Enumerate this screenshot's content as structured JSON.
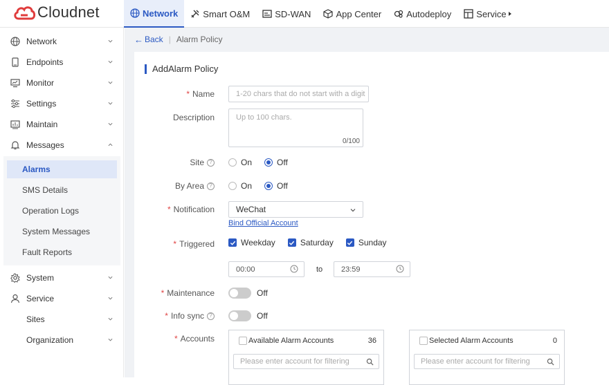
{
  "brand": {
    "name": "Cloudnet",
    "color": "#e03c3c"
  },
  "topnav": [
    {
      "label": "Network",
      "icon": "globe-icon",
      "active": true
    },
    {
      "label": "Smart O&M",
      "icon": "tools-icon"
    },
    {
      "label": "SD-WAN",
      "icon": "sdwan-icon"
    },
    {
      "label": "App Center",
      "icon": "cube-icon"
    },
    {
      "label": "Autodeploy",
      "icon": "deploy-icon"
    },
    {
      "label": "Service",
      "icon": "service-icon"
    }
  ],
  "sidebar": {
    "items": [
      {
        "label": "Network",
        "icon": "globe-icon"
      },
      {
        "label": "Endpoints",
        "icon": "device-icon"
      },
      {
        "label": "Monitor",
        "icon": "monitor-icon"
      },
      {
        "label": "Settings",
        "icon": "sliders-icon"
      },
      {
        "label": "Maintain",
        "icon": "chart-icon"
      },
      {
        "label": "Messages",
        "icon": "bell-icon",
        "expanded": true
      },
      {
        "label": "System",
        "icon": "gear-icon"
      },
      {
        "label": "Service",
        "icon": "user-icon"
      },
      {
        "label": "Sites",
        "icon": ""
      },
      {
        "label": "Organization",
        "icon": ""
      }
    ],
    "messages_sub": [
      {
        "label": "Alarms",
        "active": true
      },
      {
        "label": "SMS Details"
      },
      {
        "label": "Operation Logs"
      },
      {
        "label": "System Messages"
      },
      {
        "label": "Fault Reports"
      }
    ]
  },
  "breadcrumb": {
    "back": "Back",
    "current": "Alarm Policy"
  },
  "form": {
    "title": "AddAlarm Policy",
    "name": {
      "label": "Name",
      "placeholder": "1-20 chars that do not start with a digit"
    },
    "description": {
      "label": "Description",
      "placeholder": "Up to 100 chars.",
      "counter": "0/100"
    },
    "site": {
      "label": "Site",
      "on": "On",
      "off": "Off",
      "selected": "Off"
    },
    "by_area": {
      "label": "By Area",
      "on": "On",
      "off": "Off",
      "selected": "Off"
    },
    "notification": {
      "label": "Notification",
      "value": "WeChat",
      "link": "Bind Official Account"
    },
    "triggered": {
      "label": "Triggered",
      "days": [
        "Weekday",
        "Saturday",
        "Sunday"
      ],
      "start": "00:00",
      "to": "to",
      "end": "23:59"
    },
    "maintenance": {
      "label": "Maintenance",
      "state": "Off"
    },
    "info_sync": {
      "label": "Info sync",
      "state": "Off"
    },
    "accounts": {
      "label": "Accounts",
      "available": {
        "title": "Available Alarm Accounts",
        "count": "36",
        "placeholder": "Please enter account for filtering"
      },
      "selected": {
        "title": "Selected Alarm Accounts",
        "count": "0",
        "placeholder": "Please enter account for filtering"
      }
    }
  },
  "colors": {
    "accent": "#2b59c3",
    "required": "#e04545",
    "background": "#f0f2f5"
  }
}
